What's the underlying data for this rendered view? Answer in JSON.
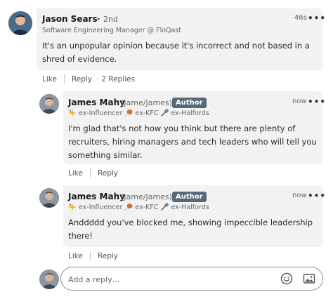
{
  "comment": {
    "author": "Jason Sears",
    "degree": "• 2nd",
    "subtitle": "Software Engineering Manager @ FloQast",
    "time": "46s",
    "more": "•••",
    "text": "It's an unpopular opinion because it's incorrect and not based in a shred of evidence.",
    "actions": {
      "like": "Like",
      "reply": "Reply",
      "replies": "2 Replies",
      "dot": "·"
    }
  },
  "replies": [
    {
      "author": "James Mahy",
      "handle": "(Jame/James)",
      "badge": "Author",
      "badges": [
        "ex-Influencer",
        "ex-KFC",
        "ex-Halfords"
      ],
      "time": "now",
      "more": "•••",
      "text": "I'm glad that's not how you think but there are plenty of recruiters, hiring managers and tech leaders who will tell you something similar.",
      "actions": {
        "like": "Like",
        "reply": "Reply"
      }
    },
    {
      "author": "James Mahy",
      "handle": "(Jame/James)",
      "badge": "Author",
      "badges": [
        "ex-Influencer",
        "ex-KFC",
        "ex-Halfords"
      ],
      "time": "now",
      "more": "•••",
      "text": "Anddddd you've blocked me, showing impeccible leadership there!",
      "actions": {
        "like": "Like",
        "reply": "Reply"
      }
    }
  ],
  "reply_box": {
    "placeholder": "Add a reply…",
    "emoji_icon": "emoji-icon",
    "image_icon": "image-icon"
  },
  "colors": {
    "bubble": "#f2f2f2",
    "badge": "#56687a",
    "reply_border": "#8c8c8c"
  }
}
